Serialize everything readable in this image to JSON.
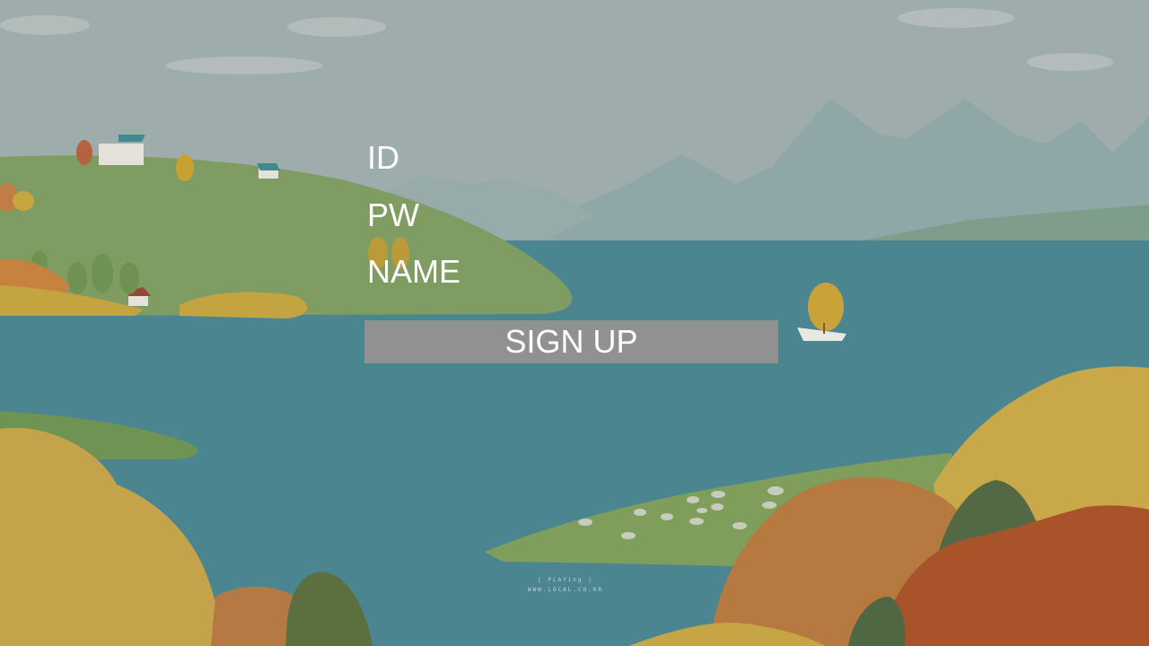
{
  "form": {
    "id_placeholder": "ID",
    "pw_placeholder": "PW",
    "name_placeholder": "NAME",
    "signup_label": "SIGN UP"
  },
  "background": {
    "watermark_top": "| PLAYing |",
    "watermark_bottom": "WWW.LOCAL.CO.KR"
  },
  "colors": {
    "sky": "#9eacab",
    "lake": "#4b8690",
    "button": "#919191",
    "text": "#ffffff"
  }
}
